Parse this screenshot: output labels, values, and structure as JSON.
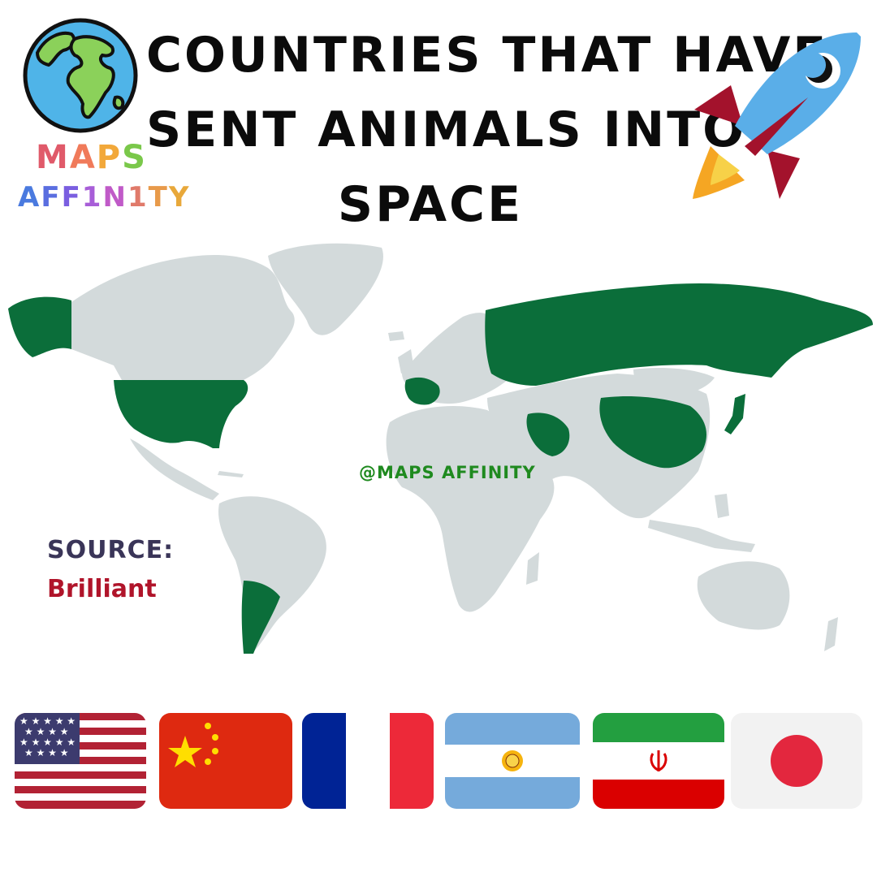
{
  "title": {
    "line1": "COUNTRIES THAT HAVE",
    "line2": "SENT ANIMALS INTO",
    "line3": "SPACE"
  },
  "brand": {
    "line1_letters": [
      {
        "ch": "M",
        "color": "#e05a6a"
      },
      {
        "ch": "A",
        "color": "#f07a5a"
      },
      {
        "ch": "P",
        "color": "#f2a83a"
      },
      {
        "ch": "S",
        "color": "#7ac84a"
      }
    ],
    "line2_letters": [
      {
        "ch": "A",
        "color": "#4a7adf"
      },
      {
        "ch": "F",
        "color": "#5a6ee0"
      },
      {
        "ch": "F",
        "color": "#7a5ee0"
      },
      {
        "ch": "1",
        "color": "#a85ed8"
      },
      {
        "ch": "N",
        "color": "#c05ac8"
      },
      {
        "ch": "1",
        "color": "#e07a6a"
      },
      {
        "ch": "T",
        "color": "#e89a4a"
      },
      {
        "ch": "Y",
        "color": "#e8a83a"
      }
    ]
  },
  "watermark": "@MAPS AFFINITY",
  "source": {
    "label": "SOURCE:",
    "value": "Brilliant"
  },
  "map": {
    "highlight_color": "#0b6e3a",
    "land_color": "#d3dadb",
    "highlighted_countries": [
      "United States",
      "Russia",
      "China",
      "France",
      "Argentina",
      "Iran",
      "Japan"
    ]
  },
  "flags": [
    {
      "country": "United States",
      "icon": "usa-flag-icon"
    },
    {
      "country": "China",
      "icon": "china-flag-icon"
    },
    {
      "country": "France",
      "icon": "france-flag-icon"
    },
    {
      "country": "Argentina",
      "icon": "argentina-flag-icon"
    },
    {
      "country": "Iran",
      "icon": "iran-flag-icon"
    },
    {
      "country": "Japan",
      "icon": "japan-flag-icon"
    }
  ]
}
